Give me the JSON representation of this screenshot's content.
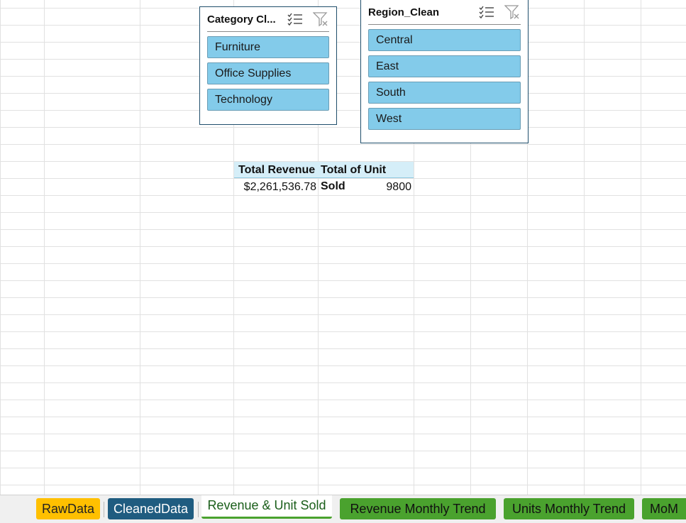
{
  "slicers": {
    "category": {
      "title": "Category Cl...",
      "items": [
        "Furniture",
        "Office Supplies",
        "Technology"
      ]
    },
    "region": {
      "title": "Region_Clean",
      "items": [
        "Central",
        "East",
        "South",
        "West"
      ]
    },
    "multi_select_icon": "multi-select-icon",
    "clear_filter_icon": "clear-filter-icon"
  },
  "pivot": {
    "headers": [
      "Total Revenue",
      "Total of Unit Sold"
    ],
    "values": [
      "$2,261,536.78",
      "9800"
    ]
  },
  "sheet_tabs": [
    {
      "label": "RawData",
      "color": "#ffc000",
      "active": false
    },
    {
      "label": "CleanedData",
      "color": "#1f5c80",
      "active": false
    },
    {
      "label": "Revenue & Unit Sold",
      "color": "#4aa22e",
      "active": true
    },
    {
      "label": "Revenue Monthly Trend",
      "color": "#4aa22e",
      "active": false
    },
    {
      "label": "Units Monthly Trend",
      "color": "#4aa22e",
      "active": false
    },
    {
      "label": "MoM",
      "color": "#4aa22e",
      "active": false
    }
  ],
  "colors": {
    "slicer_item": "#83cbea",
    "slicer_border": "#1f4e6b",
    "pivot_header": "#d5eef8"
  }
}
